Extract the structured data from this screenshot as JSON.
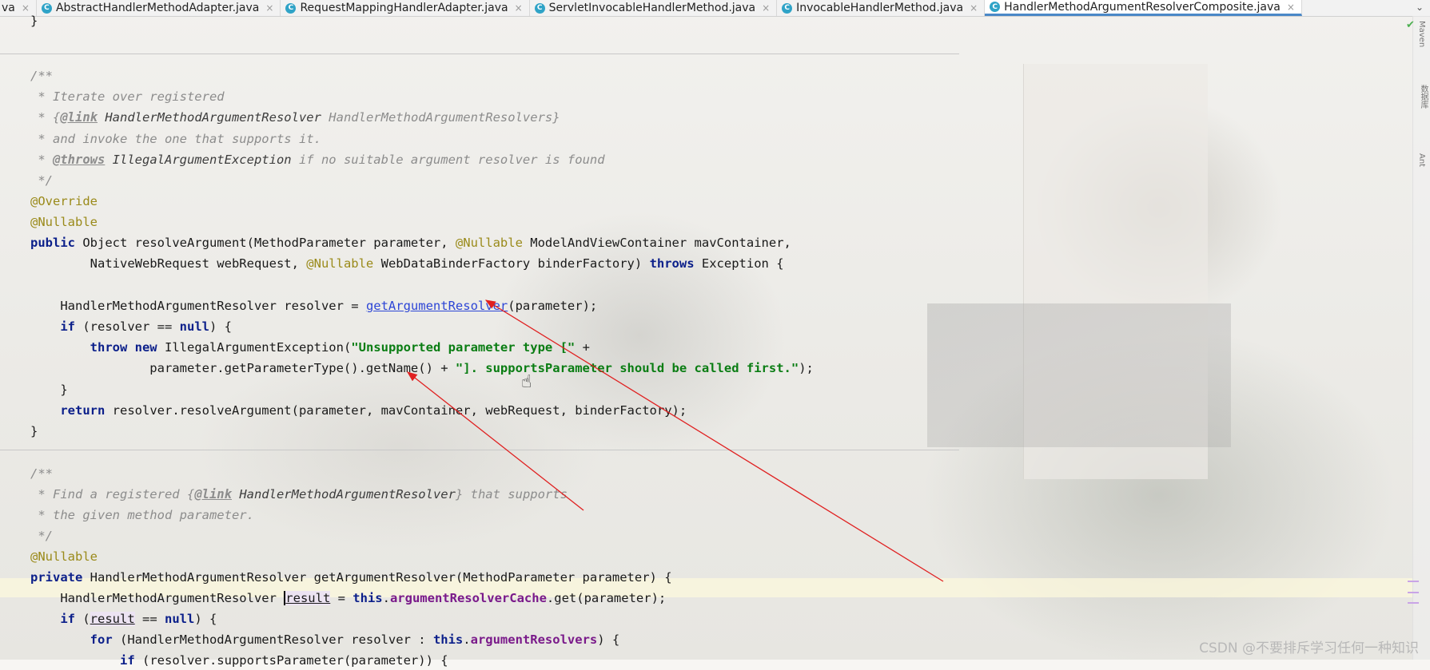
{
  "tabs": [
    {
      "label": "va",
      "icon": "",
      "active": false
    },
    {
      "label": "AbstractHandlerMethodAdapter.java",
      "icon": "C",
      "active": false
    },
    {
      "label": "RequestMappingHandlerAdapter.java",
      "icon": "C",
      "active": false
    },
    {
      "label": "ServletInvocableHandlerMethod.java",
      "icon": "C",
      "active": false
    },
    {
      "label": "InvocableHandlerMethod.java",
      "icon": "C",
      "active": false
    },
    {
      "label": "HandlerMethodArgumentResolverComposite.java",
      "icon": "C",
      "active": true
    }
  ],
  "tab_close_glyph": "×",
  "tab_dropdown_glyph": "⌄",
  "sidebar": {
    "maven": "Maven",
    "database": "数据库",
    "ant": "Ant"
  },
  "status_check": "✔",
  "code": {
    "l1": "}",
    "l2": "/**",
    "l3": " * Iterate over registered",
    "l4_a": " * {",
    "l4_b": "@link",
    "l4_c": " HandlerMethodArgumentResolver",
    "l4_d": " HandlerMethodArgumentResolvers}",
    "l5": " * and invoke the one that supports it.",
    "l6_a": " * ",
    "l6_b": "@throws",
    "l6_c": " IllegalArgumentException",
    "l6_d": " if no suitable argument resolver is found",
    "l7": " */",
    "l8": "@Override",
    "l9": "@Nullable",
    "l10_a": "public",
    "l10_b": " Object resolveArgument(MethodParameter parameter, ",
    "l10_c": "@Nullable",
    "l10_d": " ModelAndViewContainer mavContainer,",
    "l11_a": "        NativeWebRequest webRequest, ",
    "l11_b": "@Nullable",
    "l11_c": " WebDataBinderFactory binderFactory) ",
    "l11_d": "throws",
    "l11_e": " Exception {",
    "l13_a": "    HandlerMethodArgumentResolver resolver = ",
    "l13_b": "getArgumentResolver",
    "l13_c": "(parameter);",
    "l14_a": "    ",
    "l14_b": "if",
    "l14_c": " (resolver == ",
    "l14_d": "null",
    "l14_e": ") {",
    "l15_a": "        ",
    "l15_b": "throw new",
    "l15_c": " IllegalArgumentException(",
    "l15_d": "\"Unsupported parameter type [\"",
    "l15_e": " +",
    "l16_a": "                parameter.getParameterType().getName() + ",
    "l16_b": "\"]. supportsParameter should be called first.\"",
    "l16_c": ");",
    "l17": "    }",
    "l18_a": "    ",
    "l18_b": "return",
    "l18_c": " resolver.resolveArgument(parameter, mavContainer, webRequest, binderFactory);",
    "l19": "}",
    "l20": "/**",
    "l21_a": " * Find a registered {",
    "l21_b": "@link",
    "l21_c": " HandlerMethodArgumentResolver",
    "l21_d": "} that supports",
    "l22": " * the given method parameter.",
    "l23": " */",
    "l24": "@Nullable",
    "l25_a": "private",
    "l25_b": " HandlerMethodArgumentResolver getArgumentResolver(MethodParameter parameter) {",
    "l26_a": "    HandlerMethodArgumentResolver ",
    "l26_b": "result",
    "l26_c": " = ",
    "l26_d": "this",
    "l26_e": ".",
    "l26_f": "argumentResolverCache",
    "l26_g": ".get(parameter);",
    "l27_a": "    ",
    "l27_b": "if",
    "l27_c": " (",
    "l27_d": "result",
    "l27_e": " == ",
    "l27_f": "null",
    "l27_g": ") {",
    "l28_a": "        ",
    "l28_b": "for",
    "l28_c": " (HandlerMethodArgumentResolver resolver : ",
    "l28_d": "this",
    "l28_e": ".",
    "l28_f": "argumentResolvers",
    "l28_g": ") {",
    "l29_a": "            ",
    "l29_b": "if",
    "l29_c": " (resolver.supportsParameter(parameter)) {"
  },
  "watermark": "CSDN @不要排斥学习任何一种知识",
  "arrow_color": "#e02020"
}
